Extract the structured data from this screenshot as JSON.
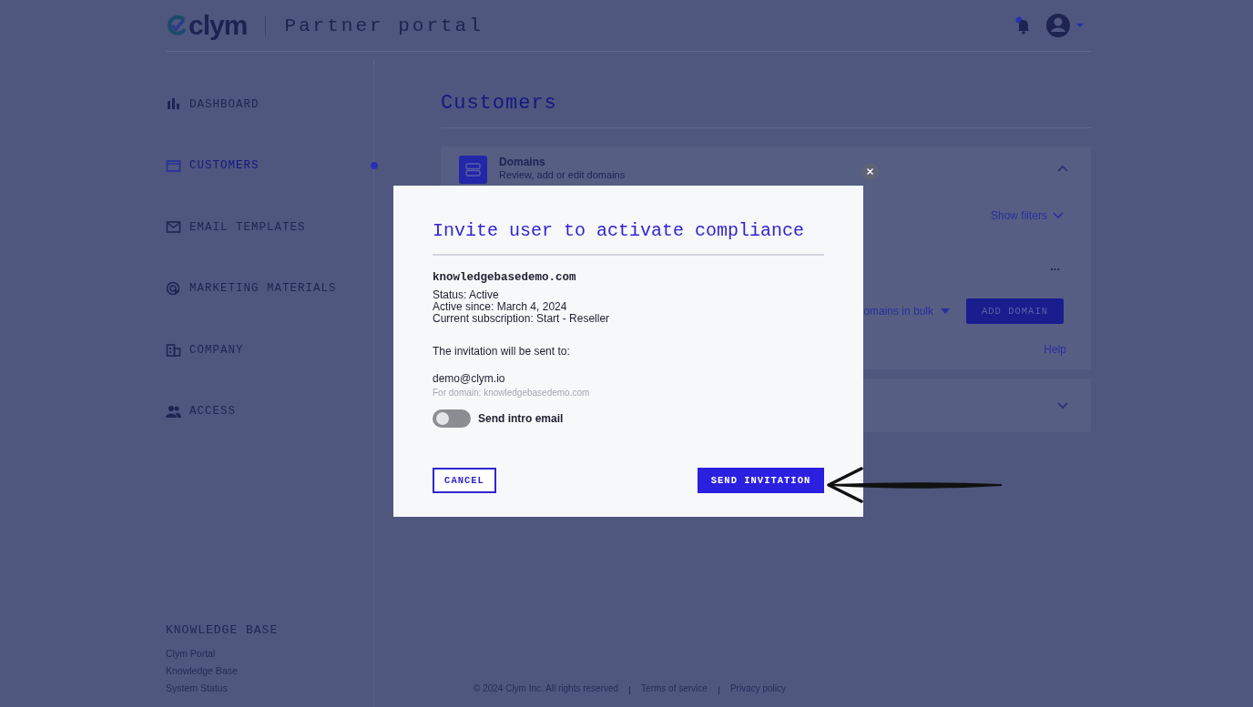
{
  "header": {
    "logo": "clym",
    "title": "Partner portal"
  },
  "sidebar": {
    "items": [
      {
        "label": "DASHBOARD",
        "selected": false
      },
      {
        "label": "CUSTOMERS",
        "selected": true
      },
      {
        "label": "EMAIL TEMPLATES",
        "selected": false
      },
      {
        "label": "MARKETING MATERIALS",
        "selected": false
      },
      {
        "label": "COMPANY",
        "selected": false
      },
      {
        "label": "ACCESS",
        "selected": false
      }
    ],
    "knowledge_base": {
      "heading": "KNOWLEDGE BASE",
      "links": [
        "Clym Portal",
        "Knowledge Base",
        "System Status"
      ]
    }
  },
  "main": {
    "title": "Customers",
    "panels": [
      {
        "title": "Domains",
        "subtitle": "Review, add or edit domains",
        "expanded": true,
        "show_filters": "Show filters",
        "more": "...",
        "bulk": "omains in bulk",
        "add_button": "ADD DOMAIN",
        "help": "Help"
      },
      {
        "expanded": false
      }
    ]
  },
  "footer": {
    "copyright": "© 2024 Clym Inc. All rights reserved",
    "links": [
      "Terms of service",
      "Privacy policy"
    ]
  },
  "dialog": {
    "title": "Invite user to activate compliance",
    "domain": "knowledgebasedemo.com",
    "details": [
      "Status: Active",
      "Active since: March 4, 2024",
      "Current subscription: Start - Reseller"
    ],
    "sent_to_label": "The invitation will be sent to:",
    "email": "demo@clym.io",
    "for_domain": "For domain: knowledgebasedemo.com",
    "toggle": {
      "label": "Send intro email",
      "on": false
    },
    "cancel": "CANCEL",
    "send": "SEND INVITATION"
  }
}
